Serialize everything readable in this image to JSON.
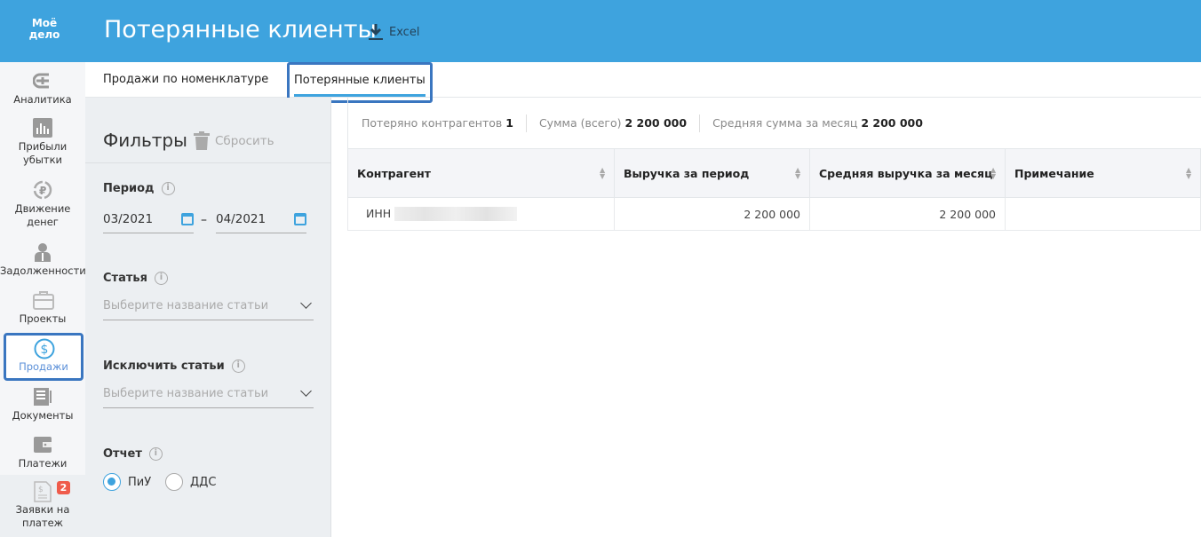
{
  "header": {
    "logo": "Моё дело",
    "title": "Потерянные клиенты",
    "export_label": "Excel"
  },
  "sidebar": {
    "items": [
      {
        "label": "Аналитика",
        "icon": "analytics-icon"
      },
      {
        "label": "Прибыли убытки",
        "icon": "bar-chart-icon"
      },
      {
        "label": "Движение денег",
        "icon": "ruble-cycle-icon"
      },
      {
        "label": "Задолженности",
        "icon": "person-icon"
      },
      {
        "label": "Проекты",
        "icon": "briefcase-icon"
      },
      {
        "label": "Продажи",
        "icon": "dollar-icon"
      },
      {
        "label": "Документы",
        "icon": "document-icon"
      },
      {
        "label": "Платежи",
        "icon": "wallet-icon"
      },
      {
        "label": "Заявки на платеж",
        "icon": "invoice-icon",
        "badge": "2"
      }
    ]
  },
  "tabs": [
    {
      "label": "Продажи по номенклатуре"
    },
    {
      "label": "Потерянные клиенты",
      "active": true
    }
  ],
  "filters": {
    "title": "Фильтры",
    "reset": "Сбросить",
    "period_label": "Период",
    "date_from": "03/2021",
    "date_sep": "–",
    "date_to": "04/2021",
    "article_label": "Статья",
    "article_placeholder": "Выберите название статьи",
    "exclude_label": "Исключить статьи",
    "exclude_placeholder": "Выберите название статьи",
    "report_label": "Отчет",
    "report_options": [
      "ПиУ",
      "ДДС"
    ],
    "report_selected": "ПиУ"
  },
  "summary": {
    "lost_label": "Потеряно контрагентов",
    "lost_value": "1",
    "sum_label": "Сумма (всего)",
    "sum_value": "2 200 000",
    "avg_label": "Средняя сумма за месяц",
    "avg_value": "2 200 000"
  },
  "table": {
    "columns": [
      "Контрагент",
      "Выручка за период",
      "Средняя выручка за месяц",
      "Примечание"
    ],
    "rows": [
      {
        "counterparty": "ИНН",
        "revenue": "2 200 000",
        "avg_revenue": "2 200 000",
        "note": ""
      }
    ]
  }
}
